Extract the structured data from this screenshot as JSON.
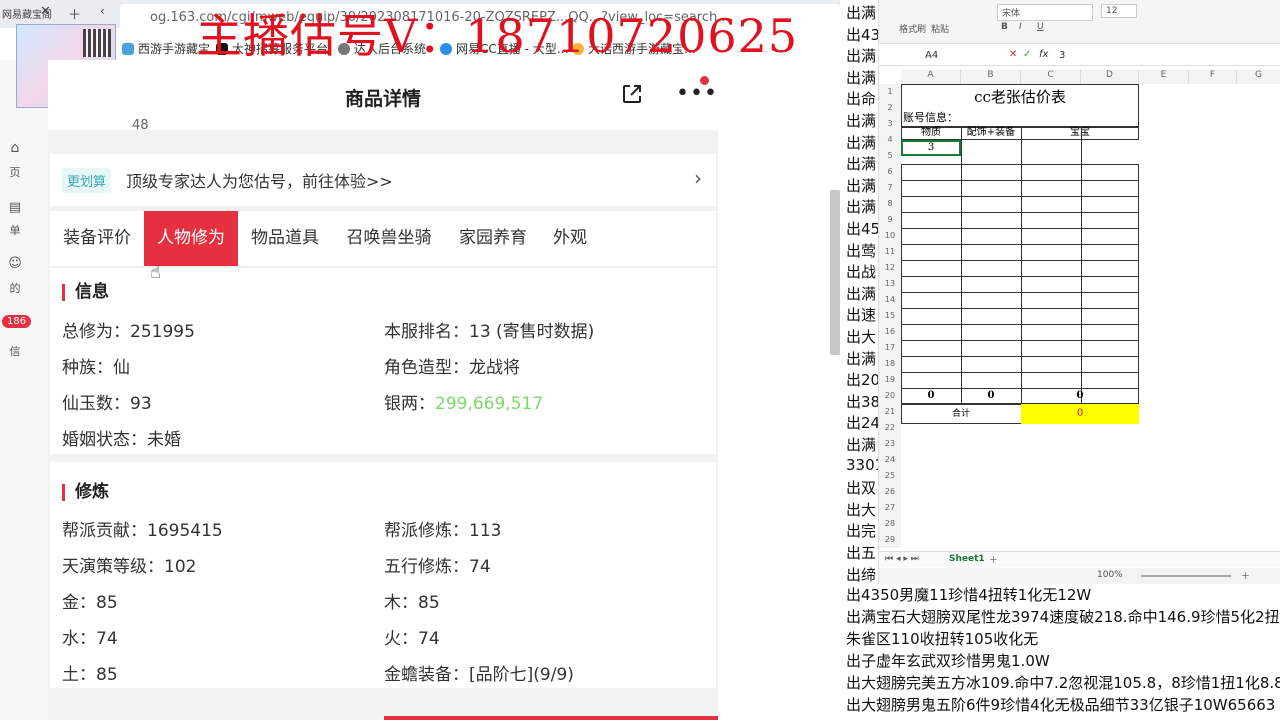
{
  "overlay": {
    "title": "主播估号V：18710720625"
  },
  "browser": {
    "tab_label": "网易藏宝阁",
    "url": "og.163.com/cgi/mweb/equip/30/202308171016-20-ZOZSREPZ...QQ...?view_loc=search...",
    "bookmarks": [
      "西游手游藏宝…",
      "大神招募服务平台",
      "达人后台系统",
      "网易CC直播 - 大型…",
      "大话西游手游藏宝…"
    ]
  },
  "left_nav": {
    "items": [
      "页",
      "单",
      "的",
      "信"
    ],
    "badge": "186"
  },
  "page": {
    "title": "商品详情",
    "partial_number": "48",
    "banner": {
      "tag": "更划算",
      "text": "顶级专家达人为您估号，前往体验>>"
    },
    "tabs": [
      "装备评价",
      "人物修为",
      "物品道具",
      "召唤兽坐骑",
      "家园养育",
      "外观"
    ],
    "active_tab": "人物修为"
  },
  "info": {
    "title": "信息",
    "rows": [
      {
        "label": "总修为：",
        "value": "251995"
      },
      {
        "label": "本服排名：",
        "value": "13 (寄售时数据)"
      },
      {
        "label": "种族：",
        "value": "仙"
      },
      {
        "label": "角色造型：",
        "value": "龙战将"
      },
      {
        "label": "仙玉数：",
        "value": "93"
      },
      {
        "label": "银两：",
        "value": "299,669,517"
      },
      {
        "label": "婚姻状态：",
        "value": "未婚"
      }
    ]
  },
  "cultivation": {
    "title": "修炼",
    "rows": [
      {
        "label": "帮派贡献：",
        "value": "1695415"
      },
      {
        "label": "帮派修炼：",
        "value": "113"
      },
      {
        "label": "天演策等级：",
        "value": "102"
      },
      {
        "label": "五行修炼：",
        "value": "74"
      },
      {
        "label": "金：",
        "value": "85"
      },
      {
        "label": "木：",
        "value": "85"
      },
      {
        "label": "水：",
        "value": "74"
      },
      {
        "label": "火：",
        "value": "74"
      },
      {
        "label": "土：",
        "value": "85"
      },
      {
        "label": "金蟾装备：",
        "value": "[品阶七](9/9)"
      }
    ]
  },
  "spreadsheet": {
    "font_label": "宋体",
    "font_size": "12",
    "cell_ref": "A4",
    "formula_value": "3",
    "columns": [
      "A",
      "B",
      "C",
      "D",
      "E",
      "F",
      "G"
    ],
    "title": "cc老张估价表",
    "account_label": "账号信息：",
    "headers": [
      "物质",
      "配饰+装备",
      "宝宝"
    ],
    "cell_a4": "3",
    "totals": [
      "0",
      "0",
      "0"
    ],
    "sum_label": "合计",
    "sum_value": "0",
    "sheet_tab": "Sheet1",
    "zoom": "100%",
    "ribbon_labels": [
      "格式刷",
      "粘贴",
      "B",
      "I",
      "U"
    ]
  },
  "right_list": {
    "prefix_items": [
      "出满",
      "出43",
      "出满",
      "出满",
      "出命",
      "出满",
      "出满",
      "出满",
      "出满",
      "出满",
      "出45",
      "出莺",
      "出战",
      "出满",
      "出速",
      "出大",
      "出满",
      "出20",
      "出38",
      "出24",
      "出满",
      "3301",
      "出双",
      "出大",
      "出完",
      "出五",
      "出缔"
    ],
    "full_items": [
      "出4350男魔11珍惜4扭转1化无12W",
      "出满宝石大翅膀双尾性龙3974速度破218.命中146.9珍惜5化2扭",
      "朱雀区110收扭转105收化无",
      "出子虚年玄武双珍惜男鬼1.0W",
      "出大翅膀完美五方冰109.命中7.2忽视混105.8，8珍惜1扭1化8.8W",
      "出大翅膀男鬼五阶6件9珍惜4化无极品细节33亿银子10W65663"
    ]
  },
  "colors": {
    "accent": "#e6303f",
    "overlay_red": "#e1121f",
    "silver_green": "#7bd86b",
    "sum_yellow": "#ffff00"
  }
}
